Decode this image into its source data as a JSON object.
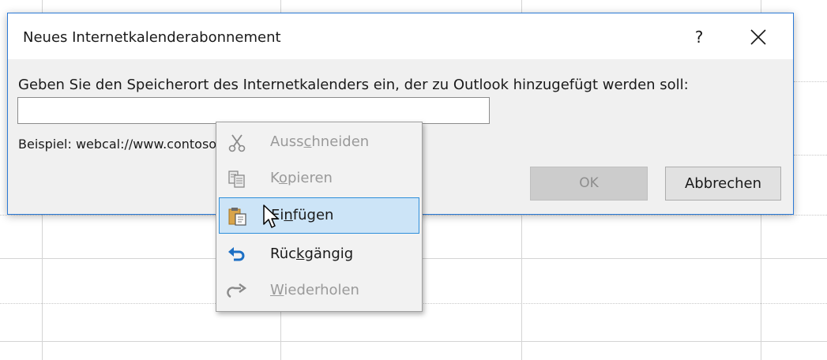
{
  "dialog": {
    "title": "Neues Internetkalenderabonnement",
    "help_label": "?",
    "prompt": "Geben Sie den Speicherort des Internetkalenders ein, der zu Outlook hinzugefügt werden soll:",
    "url_value": "",
    "example": "Beispiel: webcal://www.contoso.com/calendar/calendar.ics",
    "ok_label": "OK",
    "cancel_label": "Abbrechen"
  },
  "context_menu": {
    "items": [
      {
        "pre": "Auss",
        "accel": "c",
        "post": "hneiden",
        "icon": "scissors-icon",
        "enabled": false
      },
      {
        "pre": "K",
        "accel": "o",
        "post": "pieren",
        "icon": "copy-icon",
        "enabled": false
      },
      {
        "pre": "Ei",
        "accel": "n",
        "post": "fügen",
        "icon": "paste-icon",
        "enabled": true,
        "hovered": true
      },
      {
        "pre": "Rüc",
        "accel": "k",
        "post": "gängig",
        "icon": "undo-icon",
        "enabled": true
      },
      {
        "pre": "",
        "accel": "W",
        "post": "iederholen",
        "icon": "redo-icon",
        "enabled": false
      }
    ]
  },
  "colors": {
    "dialog_border": "#2b79d6",
    "menu_hover_bg": "#cce4f7",
    "menu_hover_border": "#2e8fdb",
    "undo_arrow": "#1c6fc4"
  },
  "cursor": "arrow-pointer-icon"
}
